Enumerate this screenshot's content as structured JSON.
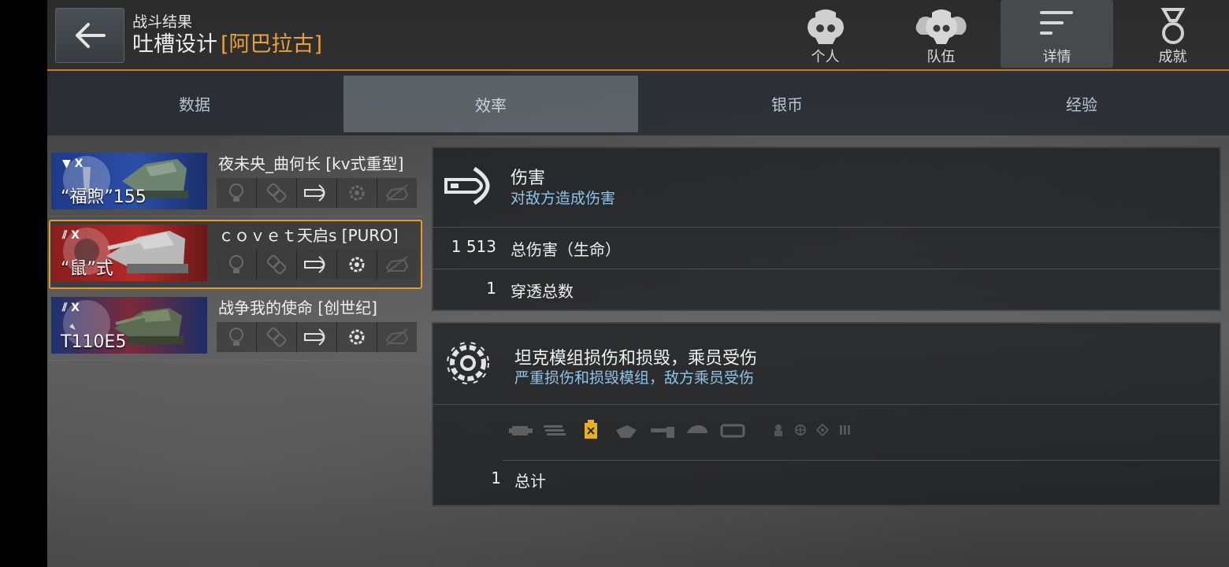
{
  "header": {
    "back_icon": "arrow-left-icon",
    "subtitle": "战斗结果",
    "map_name": "吐槽设计",
    "clan_tag": "[阿巴拉古]",
    "accent_color": "#e9a238",
    "tabs": [
      {
        "label": "个人",
        "icon": "personal-mask-icon",
        "active": false
      },
      {
        "label": "队伍",
        "icon": "team-masks-icon",
        "active": false
      },
      {
        "label": "详情",
        "icon": "details-list-icon",
        "active": true
      },
      {
        "label": "成就",
        "icon": "medal-ribbon-icon",
        "active": false
      }
    ]
  },
  "subtabs": [
    {
      "label": "数据",
      "active": false
    },
    {
      "label": "效率",
      "active": true
    },
    {
      "label": "银币",
      "active": false
    },
    {
      "label": "经验",
      "active": false
    }
  ],
  "players": [
    {
      "tank": "“福煦”155",
      "tier": "X",
      "player": "夜未央_曲何长 [kv式重型]",
      "nation": "france",
      "selected": false,
      "medals": [
        "spotting",
        "assist",
        "damage",
        "module",
        "kill"
      ],
      "active_medals": [
        2
      ]
    },
    {
      "tank": "“鼠”式",
      "tier": "X",
      "player": "ｃｏｖｅｔ天启s [PURO]",
      "nation": "germany",
      "selected": true,
      "medals": [
        "spotting",
        "assist",
        "damage",
        "module",
        "kill"
      ],
      "active_medals": [
        2,
        3
      ]
    },
    {
      "tank": "T110E5",
      "tier": "X",
      "player": "战争我的使命 [创世纪]",
      "nation": "usa",
      "selected": false,
      "medals": [
        "spotting",
        "assist",
        "damage",
        "module",
        "kill"
      ],
      "active_medals": [
        2,
        3
      ]
    }
  ],
  "damage_panel": {
    "icon": "shell-damage-icon",
    "title": "伤害",
    "subtitle": "对敌方造成伤害",
    "rows": [
      {
        "value": "1 513",
        "label": "总伤害（生命）"
      },
      {
        "value": "1",
        "label": "穿透总数"
      }
    ]
  },
  "module_panel": {
    "icon": "gear-module-icon",
    "title": "坦克模组损伤和损毁，乘员受伤",
    "subtitle": "严重损伤和损毁模组，敌方乘员受伤",
    "module_icons": [
      "engine-icon",
      "ammo-rack-icon",
      "fuel-tank-icon",
      "radio-icon",
      "gun-icon",
      "turret-icon",
      "tracks-icon",
      "commander-icon",
      "gunner-icon",
      "driver-icon",
      "loader-icon"
    ],
    "highlighted_module": "fuel-tank-icon",
    "total_value": "1",
    "total_label": "总计"
  }
}
